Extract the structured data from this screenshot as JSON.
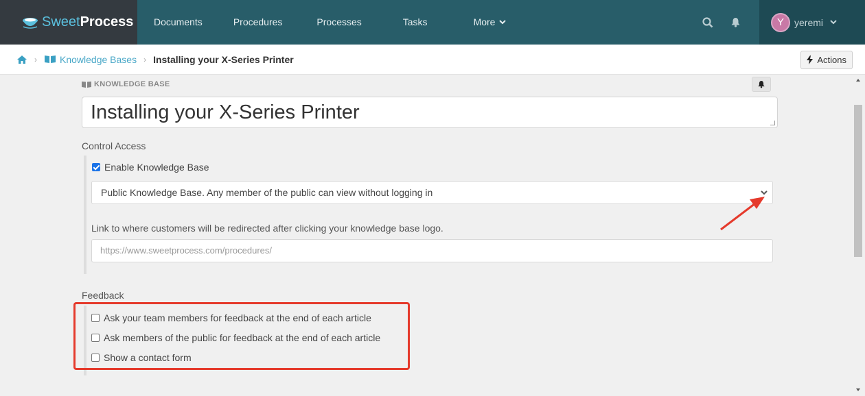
{
  "app": {
    "brand_sweet": "Sweet",
    "brand_process": "Process"
  },
  "nav": {
    "items": [
      {
        "label": "Documents"
      },
      {
        "label": "Procedures"
      },
      {
        "label": "Processes"
      },
      {
        "label": "Tasks"
      },
      {
        "label": "More"
      }
    ],
    "user": {
      "initial": "Y",
      "name": "yeremi",
      "avatar_color": "#c879a6"
    }
  },
  "breadcrumb": {
    "items": [
      {
        "label": "Knowledge Bases"
      },
      {
        "label": "Installing your X-Series Printer"
      }
    ],
    "actions_label": "Actions"
  },
  "form": {
    "section_label": "KNOWLEDGE BASE",
    "title_value": "Installing your X-Series Printer",
    "control_access": {
      "label": "Control Access",
      "enable_label": "Enable Knowledge Base",
      "enable_checked": true,
      "access_select_value": "Public Knowledge Base. Any member of the public can view without logging in",
      "redirect_help": "Link to where customers will be redirected after clicking your knowledge base logo.",
      "redirect_placeholder": "https://www.sweetprocess.com/procedures/"
    },
    "feedback": {
      "label": "Feedback",
      "options": [
        {
          "label": "Ask your team members for feedback at the end of each article",
          "checked": false
        },
        {
          "label": "Ask members of the public for feedback at the end of each article",
          "checked": false
        },
        {
          "label": "Show a contact form",
          "checked": false
        }
      ]
    }
  },
  "annotations": {
    "highlight_color": "#e53a2c"
  }
}
